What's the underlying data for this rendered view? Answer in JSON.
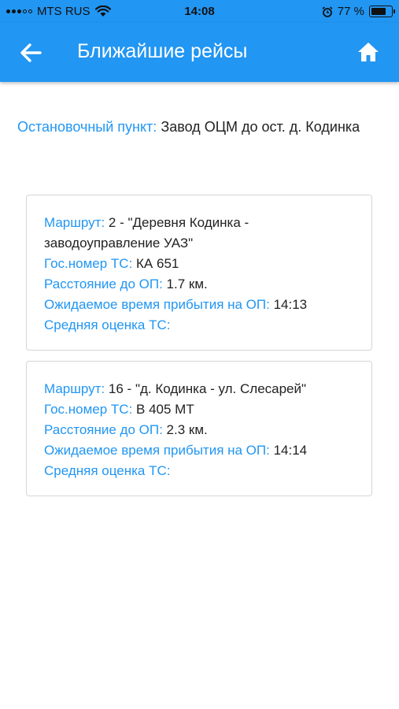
{
  "status_bar": {
    "carrier": "MTS RUS",
    "time": "14:08",
    "battery_percent": "77 %",
    "battery_level": 0.77
  },
  "header": {
    "title": "Ближайшие рейсы",
    "back_icon": "arrow-left-icon",
    "home_icon": "home-icon"
  },
  "stop": {
    "label": "Остановочный пункт:",
    "value": "Завод ОЦМ до ост. д. Кодинка"
  },
  "accent_color": "#2196F3",
  "trips": [
    {
      "route_label": "Маршрут:",
      "route_value": "2 - \"Деревня Кодинка - заводоуправление УАЗ\"",
      "plate_label": "Гос.номер ТС:",
      "plate_value": "КА 651",
      "distance_label": "Расстояние до ОП:",
      "distance_value": "1.7 км.",
      "eta_label": "Ожидаемое время прибытия на ОП:",
      "eta_value": "14:13",
      "rating_label": "Средняя оценка ТС:",
      "rating_value": ""
    },
    {
      "route_label": "Маршрут:",
      "route_value": "16 - \"д. Кодинка - ул. Слесарей\"",
      "plate_label": "Гос.номер ТС:",
      "plate_value": "В 405 МТ",
      "distance_label": "Расстояние до ОП:",
      "distance_value": "2.3 км.",
      "eta_label": "Ожидаемое время прибытия на ОП:",
      "eta_value": "14:14",
      "rating_label": "Средняя оценка ТС:",
      "rating_value": ""
    }
  ]
}
